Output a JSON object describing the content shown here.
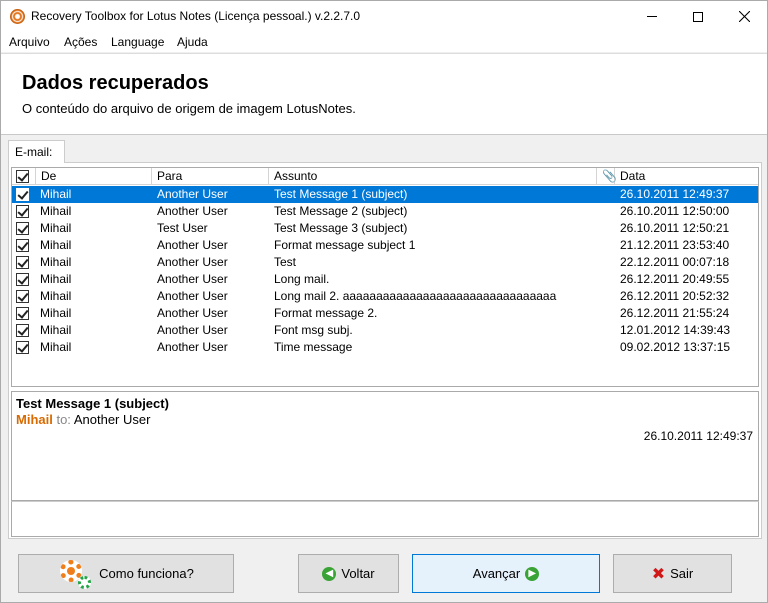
{
  "window": {
    "title": "Recovery Toolbox for Lotus Notes (Licença pessoal.) v.2.2.7.0"
  },
  "menu": [
    "Arquivo",
    "Ações",
    "Language",
    "Ajuda"
  ],
  "header": {
    "title": "Dados recuperados",
    "subtitle": "O conteúdo do arquivo de origem de imagem LotusNotes."
  },
  "tab": {
    "label": "E-mail:"
  },
  "grid": {
    "columns": {
      "de": "De",
      "para": "Para",
      "assunto": "Assunto",
      "data": "Data"
    },
    "rows": [
      {
        "de": "Mihail",
        "para": "Another User",
        "assunto": "Test Message 1 (subject)",
        "data": "26.10.2011 12:49:37"
      },
      {
        "de": "Mihail",
        "para": "Another User",
        "assunto": "Test Message 2 (subject)",
        "data": "26.10.2011 12:50:00"
      },
      {
        "de": "Mihail",
        "para": "Test User",
        "assunto": "Test Message 3 (subject)",
        "data": "26.10.2011 12:50:21"
      },
      {
        "de": "Mihail",
        "para": "Another User",
        "assunto": "Format message subject 1",
        "data": "21.12.2011 23:53:40"
      },
      {
        "de": "Mihail",
        "para": "Another User",
        "assunto": "Test",
        "data": "22.12.2011 00:07:18"
      },
      {
        "de": "Mihail",
        "para": "Another User",
        "assunto": "Long mail.",
        "data": "26.12.2011 20:49:55"
      },
      {
        "de": "Mihail",
        "para": "Another User",
        "assunto": "Long mail 2. aaaaaaaaaaaaaaaaaaaaaaaaaaaaaaaa",
        "data": "26.12.2011 20:52:32"
      },
      {
        "de": "Mihail",
        "para": "Another User",
        "assunto": "Format message 2.",
        "data": "26.12.2011 21:55:24"
      },
      {
        "de": "Mihail",
        "para": "Another User",
        "assunto": "Font msg subj.",
        "data": "12.01.2012 14:39:43"
      },
      {
        "de": "Mihail",
        "para": "Another User",
        "assunto": "Time message",
        "data": "09.02.2012 13:37:15"
      }
    ]
  },
  "preview": {
    "subject": "Test Message 1 (subject)",
    "sender": "Mihail",
    "to_label": "to:",
    "recipient": "Another User",
    "date": "26.10.2011 12:49:37"
  },
  "buttons": {
    "how": "Como funciona?",
    "back": "Voltar",
    "next": "Avançar",
    "exit": "Sair"
  },
  "colors": {
    "selection": "#0078d7",
    "sender": "#d86a00",
    "accent_green": "#3aa335",
    "exit_red": "#d01818"
  }
}
